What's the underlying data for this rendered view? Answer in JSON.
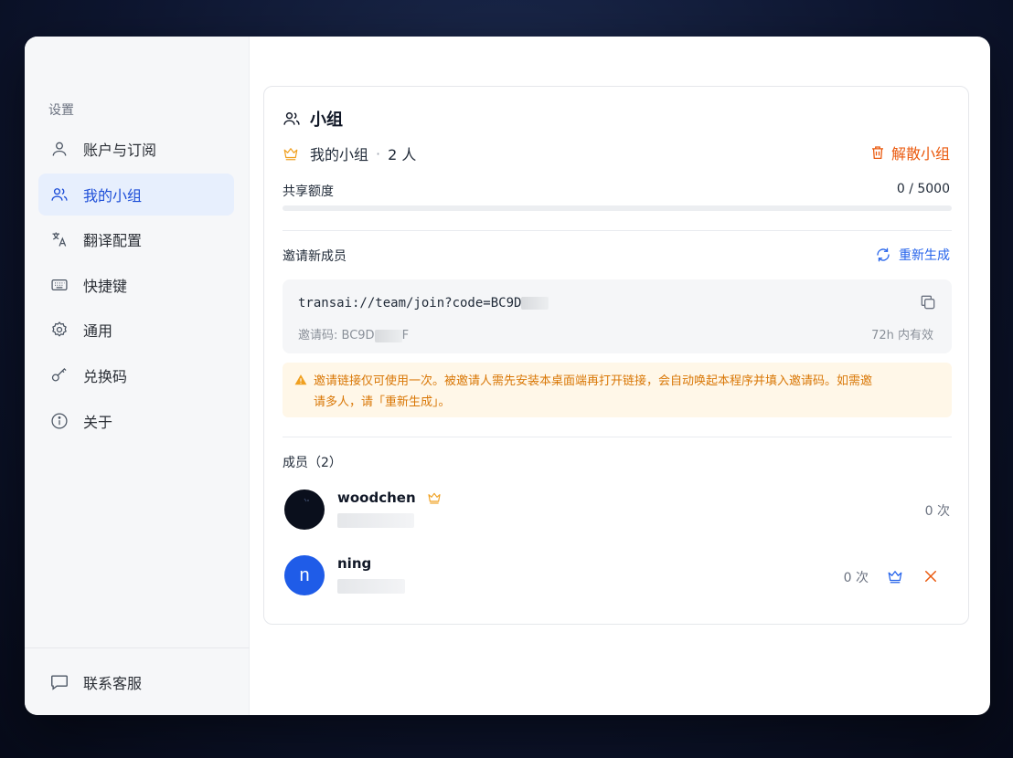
{
  "sidebar": {
    "title": "设置",
    "items": [
      {
        "label": "账户与订阅",
        "icon": "user-icon"
      },
      {
        "label": "我的小组",
        "icon": "users-icon"
      },
      {
        "label": "翻译配置",
        "icon": "translate-icon"
      },
      {
        "label": "快捷键",
        "icon": "keyboard-icon"
      },
      {
        "label": "通用",
        "icon": "gear-icon"
      },
      {
        "label": "兑换码",
        "icon": "key-icon"
      },
      {
        "label": "关于",
        "icon": "info-icon"
      }
    ],
    "active_index": 1,
    "footer_label": "联系客服"
  },
  "group": {
    "title": "小组",
    "name": "我的小组",
    "separator": "·",
    "member_count": "2 人",
    "disband_label": "解散小组",
    "quota_label": "共享额度",
    "quota_value": "0 / 5000",
    "quota_fraction": 0
  },
  "invite": {
    "title": "邀请新成员",
    "regenerate_label": "重新生成",
    "link": "transai://team/join?code=BC9D",
    "code_label": "邀请码: BC9D",
    "code_suffix": "F",
    "validity": "72h 内有效",
    "notice_line1": "邀请链接仅可使用一次。被邀请人需先安装本桌面端再打开链接，会自动唤起本程序并填入邀请码。如需邀",
    "notice_line2": "请多人，请「重新生成」。"
  },
  "members": {
    "title": "成员（2）",
    "list": [
      {
        "name": "woodchen",
        "usage": "0 次",
        "is_owner": true
      },
      {
        "name": "ning",
        "initial": "n",
        "usage": "0 次",
        "is_owner": false
      }
    ]
  },
  "colors": {
    "accent": "#2563eb",
    "danger": "#ea580c",
    "warning": "#d97706",
    "crown": "#f0a020"
  }
}
